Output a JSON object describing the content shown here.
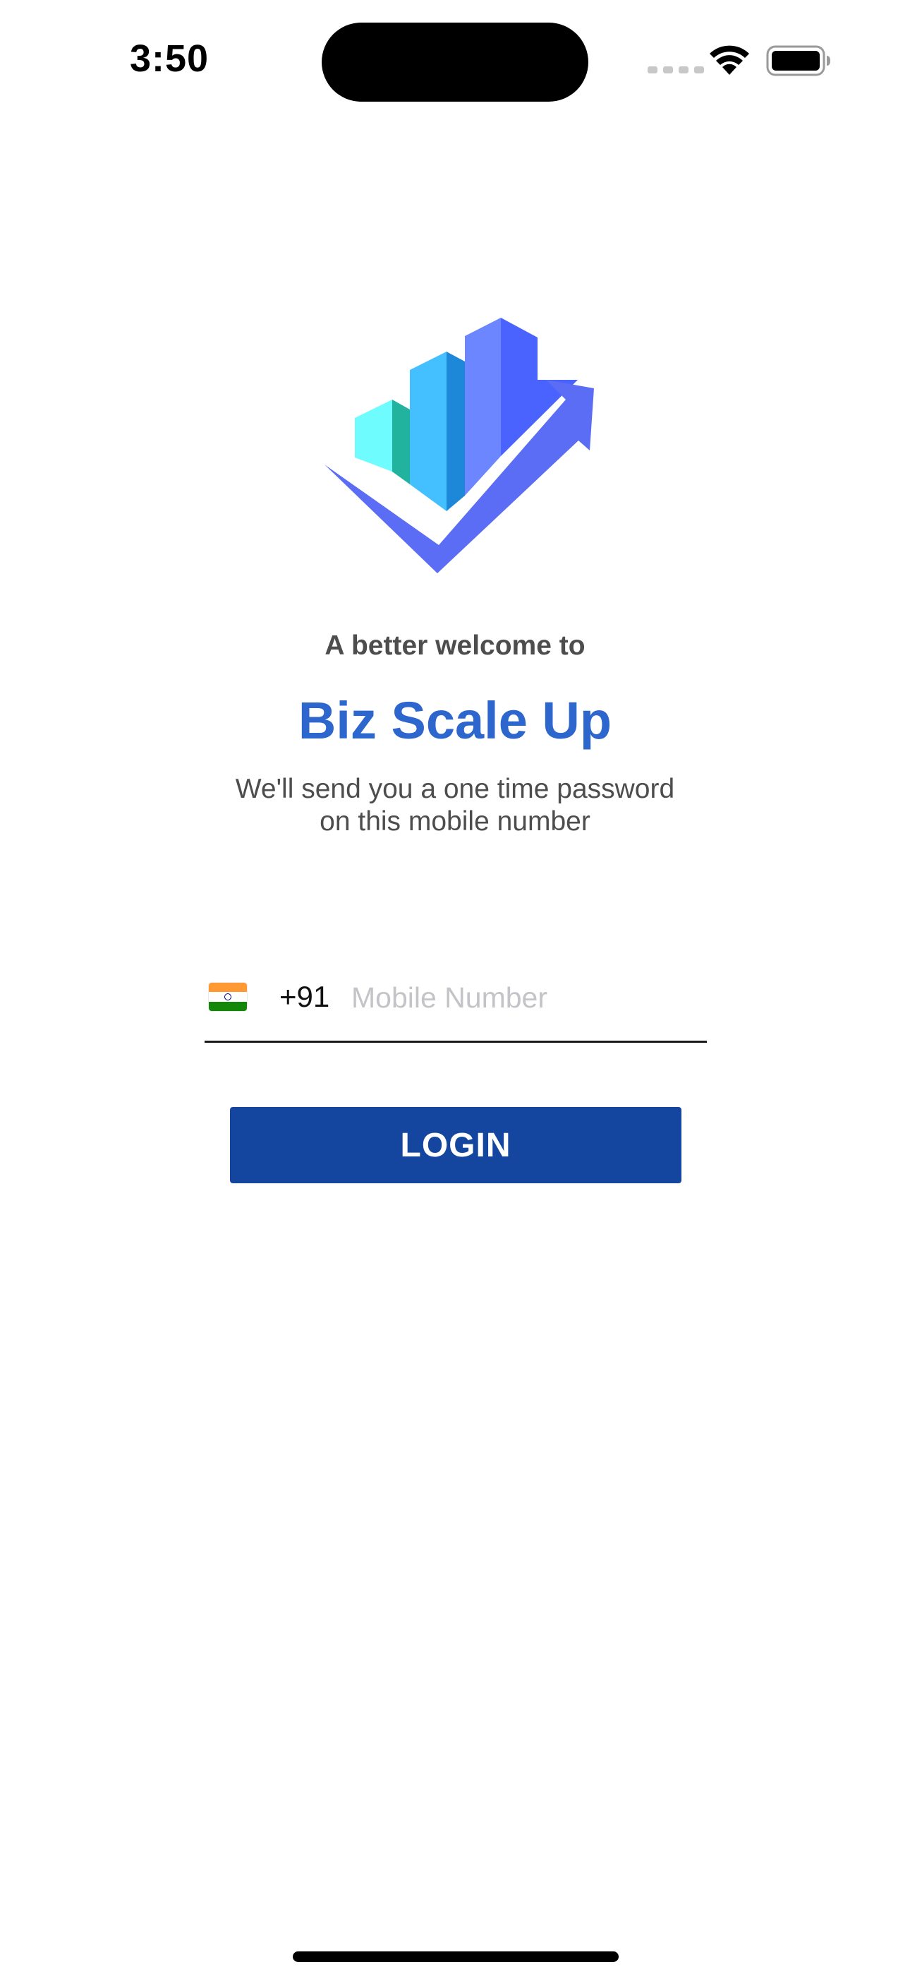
{
  "status_bar": {
    "time": "3:50",
    "icons": [
      "signal-icon",
      "wifi-icon",
      "battery-icon"
    ]
  },
  "logo": {
    "icon": "bar-chart-growth-logo",
    "colors": [
      "#6ffcff",
      "#22b39e",
      "#44bfff",
      "#1e88d8",
      "#6b86ff",
      "#4a63ff",
      "#5b6cf5"
    ]
  },
  "header": {
    "welcome_text": "A better welcome to",
    "brand_name": "Biz Scale Up",
    "subtitle_line1": "We'll send you a one time password",
    "subtitle_line2": "on this mobile number"
  },
  "phone_input": {
    "country_flag": "india-flag-icon",
    "dial_code": "+91",
    "value": "",
    "placeholder": "Mobile Number"
  },
  "login_button": {
    "label": "LOGIN"
  },
  "colors": {
    "brand": "#2d66cc",
    "button": "#1446a0",
    "text_muted": "#4d4d4d"
  }
}
